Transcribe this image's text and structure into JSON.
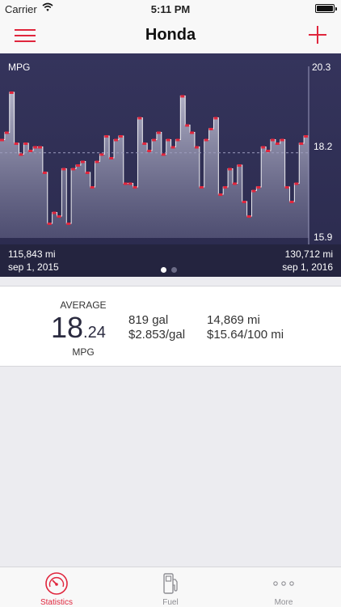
{
  "status_bar": {
    "carrier": "Carrier",
    "time": "5:11 PM"
  },
  "nav": {
    "title": "Honda"
  },
  "chart_data": {
    "type": "line",
    "title": "MPG",
    "y_ticks": [
      "20.3",
      "18.2",
      "15.9"
    ],
    "ylim": [
      15.9,
      20.3
    ],
    "start": {
      "odometer": "115,843 mi",
      "date": "sep 1, 2015"
    },
    "end": {
      "odometer": "130,712 mi",
      "date": "sep 1, 2016"
    },
    "page_dots": 2,
    "active_page": 0,
    "accent": "#e0263d",
    "series": [
      {
        "values": [
          18.6,
          18.8,
          19.9,
          18.5,
          18.2,
          18.5,
          18.3,
          18.4,
          18.4,
          17.7,
          16.3,
          16.6,
          16.5,
          17.8,
          16.3,
          17.8,
          17.9,
          18.0,
          17.7,
          17.3,
          18.0,
          18.2,
          18.7,
          18.1,
          18.6,
          18.7,
          17.4,
          17.4,
          17.3,
          19.2,
          18.5,
          18.3,
          18.6,
          18.8,
          18.2,
          18.6,
          18.4,
          18.6,
          19.8,
          19.0,
          18.8,
          18.4,
          17.3,
          18.6,
          18.9,
          19.2,
          17.1,
          17.3,
          17.8,
          17.4,
          17.9,
          16.9,
          16.5,
          17.2,
          17.3,
          18.4,
          18.3,
          18.6,
          18.5,
          18.6,
          17.3,
          16.9,
          17.4,
          18.5,
          18.7
        ]
      }
    ],
    "average_line": 18.24
  },
  "stats": {
    "average_label": "AVERAGE",
    "average_int": "18",
    "average_dec": ".24",
    "average_unit": "MPG",
    "gallons": "819 gal",
    "price_per_gal": "$2.853/gal",
    "miles": "14,869 mi",
    "cost_per_100": "$15.64/100 mi"
  },
  "tabs": [
    {
      "label": "Statistics",
      "icon": "gauge-icon",
      "active": true
    },
    {
      "label": "Fuel",
      "icon": "fuel-pump-icon",
      "active": false
    },
    {
      "label": "More",
      "icon": "more-dots-icon",
      "active": false
    }
  ],
  "colors": {
    "accent": "#e0263d",
    "chart_bg": "#2f2f55",
    "inactive": "#8e8e93"
  }
}
